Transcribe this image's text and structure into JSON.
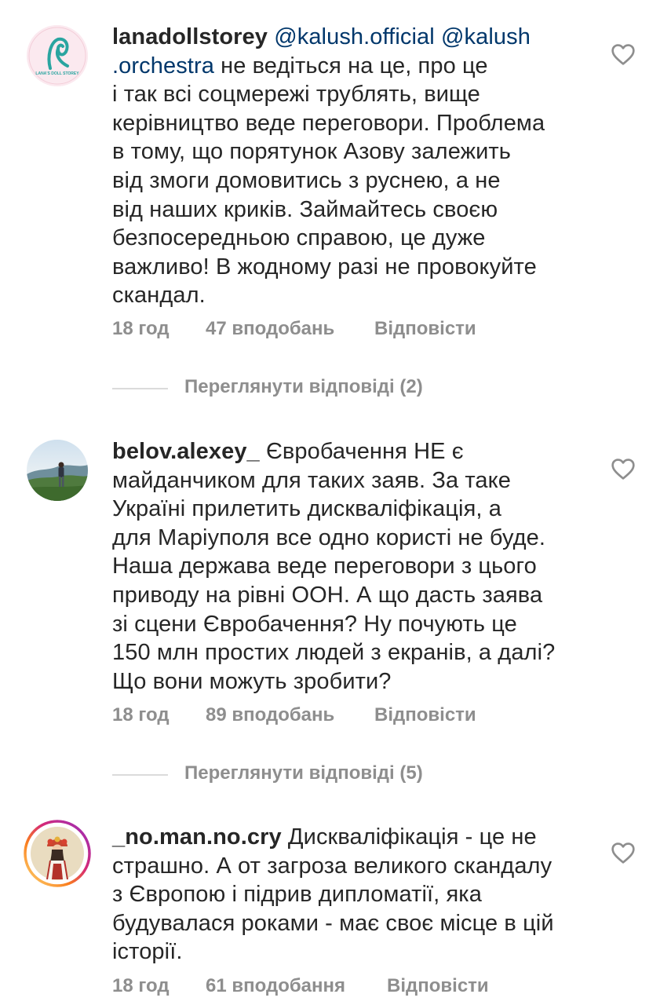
{
  "comments": [
    {
      "username": "lanadollstorey",
      "avatar_text": "LANA'S DOLL STOREY",
      "mentions": [
        "@kalush.official",
        "@kalush",
        ".orchestra"
      ],
      "text_lines": [
        "не ведіться на це, про це",
        "і так всі соцмережі трублять, вище",
        "керівництво веде переговори. Проблема",
        "в тому, що порятунок Азову залежить",
        "від змоги домовитись з руснею, а не",
        "від наших криків. Займайтесь своєю",
        "безпосередньою справою, це дуже",
        "важливо! В жодному разі не провокуйте",
        "скандал."
      ],
      "time": "18 год",
      "likes": "47 вподобань",
      "reply_label": "Відповісти",
      "view_replies": "Переглянути відповіді (2)"
    },
    {
      "username": "belov.alexey_",
      "text_lines": [
        "Євробачення НЕ є",
        "майданчиком для таких заяв. За таке",
        "Україні прилетить дискваліфікація, а",
        "для Маріуполя все одно користі не буде.",
        "Наша держава веде переговори з цього",
        "приводу на рівні ООН. А що дасть заява",
        "зі сцени Євробачення? Ну почують це",
        "150 млн простих людей з екранів, а далі?",
        "Що вони можуть зробити?"
      ],
      "time": "18 год",
      "likes": "89 вподобань",
      "reply_label": "Відповісти",
      "view_replies": "Переглянути відповіді (5)"
    },
    {
      "username": "_no.man.no.cry",
      "text_lines": [
        "Дискваліфікація - це не",
        "страшно. А от загроза великого скандалу",
        "з Європою і підрив дипломатії, яка",
        "будувалася роками - має своє місце в цій",
        "історії."
      ],
      "time": "18 год",
      "likes": "61 вподобання",
      "reply_label": "Відповісти"
    }
  ],
  "icons": {
    "like": "heart-outline-icon"
  },
  "colors": {
    "text": "#262626",
    "mention": "#00376b",
    "secondary": "#8e8e8e",
    "divider": "#dbdbdb"
  }
}
